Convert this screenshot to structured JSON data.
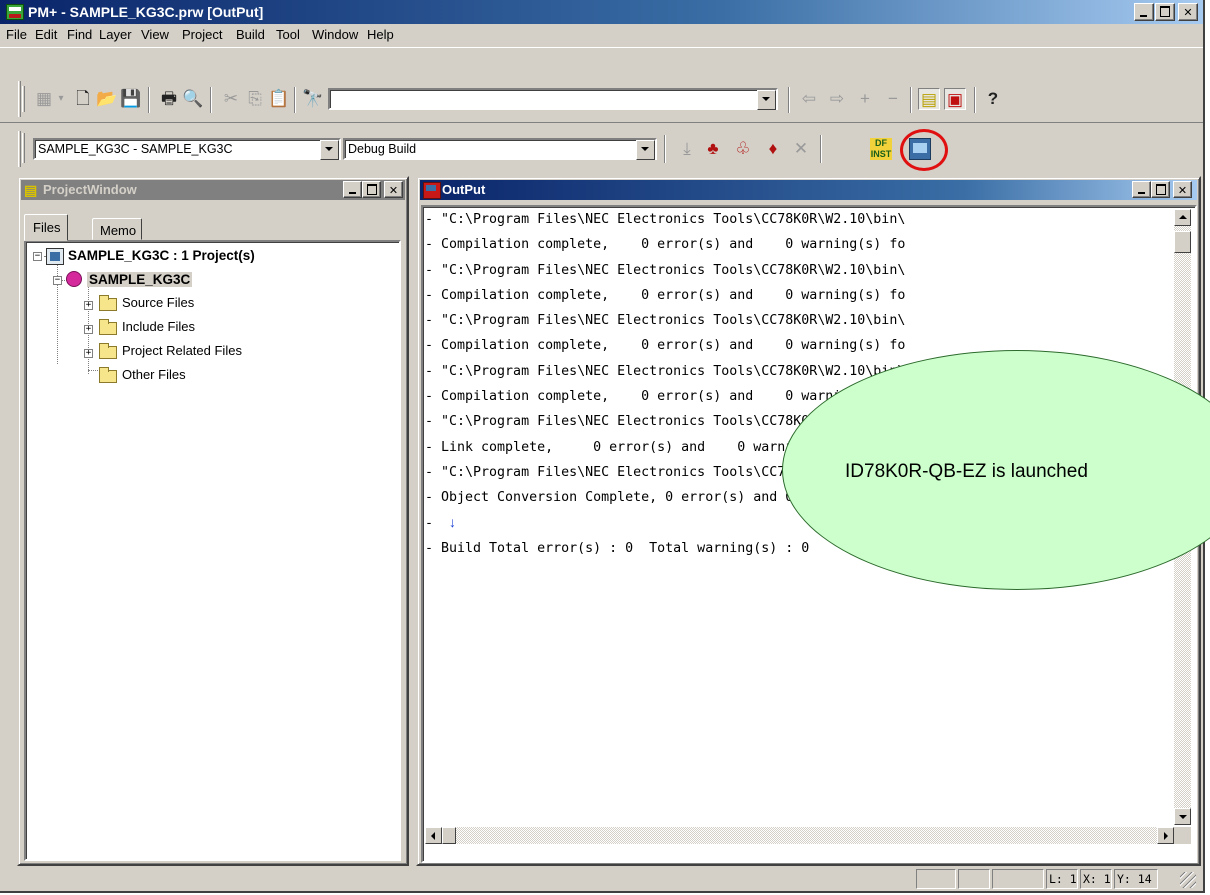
{
  "window": {
    "title": "PM+ - SAMPLE_KG3C.prw [OutPut]",
    "menu": [
      "File",
      "Edit",
      "Find",
      "Layer",
      "View",
      "Project",
      "Build",
      "Tool",
      "Window",
      "Help"
    ]
  },
  "toolbar1": {
    "icons": [
      "tool-build-icon",
      "new-file-icon",
      "open-file-icon",
      "save-icon",
      "print-icon",
      "print-preview-icon",
      "cut-icon",
      "copy-icon",
      "paste-icon",
      "find-icon",
      "back-icon",
      "forward-icon",
      "add-icon",
      "remove-icon",
      "project-window-icon",
      "output-window-icon",
      "help-icon"
    ],
    "search_value": ""
  },
  "toolbar2": {
    "project_combo": "SAMPLE_KG3C - SAMPLE_KG3C",
    "build_combo": "Debug Build"
  },
  "project_window": {
    "title": "ProjectWindow",
    "tabs": [
      "Files",
      "Memo"
    ],
    "tree": {
      "root": "SAMPLE_KG3C : 1 Project(s)",
      "project": "SAMPLE_KG3C",
      "folders": [
        "Source Files",
        "Include Files",
        "Project Related Files",
        "Other Files"
      ]
    }
  },
  "output_window": {
    "title": "OutPut",
    "lines": [
      "- \"C:\\Program Files\\NEC Electronics Tools\\CC78K0R\\W2.10\\bin\\",
      "- Compilation complete,    0 error(s) and    0 warning(s) fo",
      "- \"C:\\Program Files\\NEC Electronics Tools\\CC78K0R\\W2.10\\bin\\",
      "- Compilation complete,    0 error(s) and    0 warning(s) fo",
      "- \"C:\\Program Files\\NEC Electronics Tools\\CC78K0R\\W2.10\\bin\\",
      "- Compilation complete,    0 error(s) and    0 warning(s) fo",
      "- \"C:\\Program Files\\NEC Electronics Tools\\CC78K0R\\W2.10\\bin\\",
      "- Compilation complete,    0 error(s) and    0 warning(s) fo",
      "- \"C:\\Program Files\\NEC Electronics Tools\\CC78K0R\\W2.10\\bin\\",
      "- Link complete,     0 error(s) and    0 warning(s) found.",
      "- \"C:\\Program Files\\NEC Electronics Tools\\CC78K0R\\W2.10\\bin\\",
      "- Object Conversion Complete, 0 error(s) and 0 warning(s)",
      "- ",
      "- Build Total error(s) : 0  Total warning(s) : 0"
    ]
  },
  "callout": {
    "text": "ID78K0R-QB-EZ is launched"
  },
  "status": {
    "line": "L: 1",
    "x": "X: 1",
    "y": "Y: 14"
  },
  "colors": {
    "titlebar": "#0a246a",
    "callout_fill": "#ccffcc",
    "highlight_ring": "#e01010"
  }
}
